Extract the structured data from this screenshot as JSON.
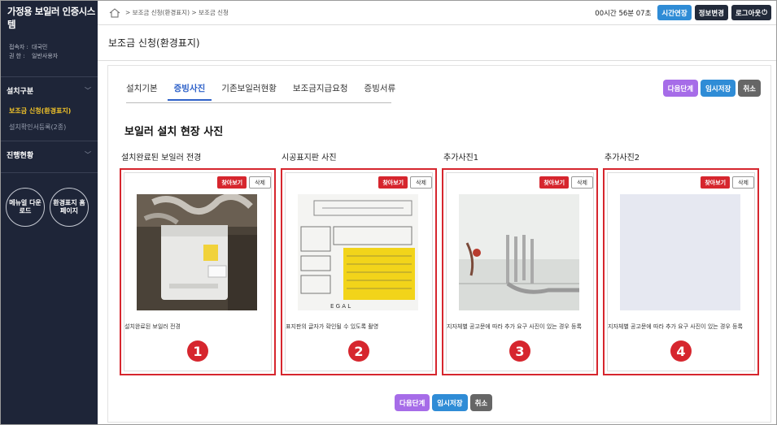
{
  "sidebar": {
    "title": "가정용 보일러 인증시스템",
    "user": [
      {
        "key": "접속자 :",
        "value": "대국민"
      },
      {
        "key": "권  한 :",
        "value": "일반사용자"
      }
    ],
    "sections": [
      {
        "label": "설치구분",
        "items": [
          {
            "label": "보조금 신청(환경표지)",
            "active": true
          },
          {
            "label": "설치확인서등록(2종)",
            "active": false
          }
        ]
      },
      {
        "label": "진행현황",
        "items": []
      }
    ],
    "circles": [
      {
        "label": "메뉴얼 다운로드"
      },
      {
        "label": "환경표지 홈페이지"
      }
    ]
  },
  "topbar": {
    "breadcrumb": "> 보조금 신청(환경표지) > 보조금 신청",
    "timer": "00시간 56분 07초",
    "buttons": {
      "extend": "시간연장",
      "profile": "정보변경",
      "logout": "로그아웃"
    }
  },
  "page": {
    "title": "보조금 신청(환경표지)"
  },
  "tabs": [
    {
      "label": "설치기본",
      "active": false
    },
    {
      "label": "증빙사진",
      "active": true
    },
    {
      "label": "기존보일러현황",
      "active": false
    },
    {
      "label": "보조금지급요청",
      "active": false
    },
    {
      "label": "증빙서류",
      "active": false
    }
  ],
  "actions": {
    "next": "다음단계",
    "save": "임시저장",
    "cancel": "취소"
  },
  "section_title": "보일러 설치 현장 사진",
  "cards": [
    {
      "label": "설치완료된 보일러 전경",
      "find": "찾아보기",
      "delete": "삭제",
      "desc": "설치완료된 보일러 전경",
      "number": "1"
    },
    {
      "label": "시공표지판 사진",
      "find": "찾아보기",
      "delete": "삭제",
      "desc": "표지판의 글자가 확인될 수 있도록 촬영",
      "number": "2"
    },
    {
      "label": "추가사진1",
      "find": "찾아보기",
      "delete": "삭제",
      "desc": "지자체별 공고문에 따라 추가 요구 사진이 있는 경우 등록",
      "number": "3"
    },
    {
      "label": "추가사진2",
      "find": "찾아보기",
      "delete": "삭제",
      "desc": "지자체별 공고문에 따라 추가 요구 사진이 있는 경우 등록",
      "number": "4"
    }
  ],
  "colors": {
    "sidebar": "#1e2538",
    "accent_red": "#d6262e",
    "tab_blue": "#2f62c9",
    "btn_blue": "#2f8cd6",
    "btn_purple": "#a66ce8"
  }
}
